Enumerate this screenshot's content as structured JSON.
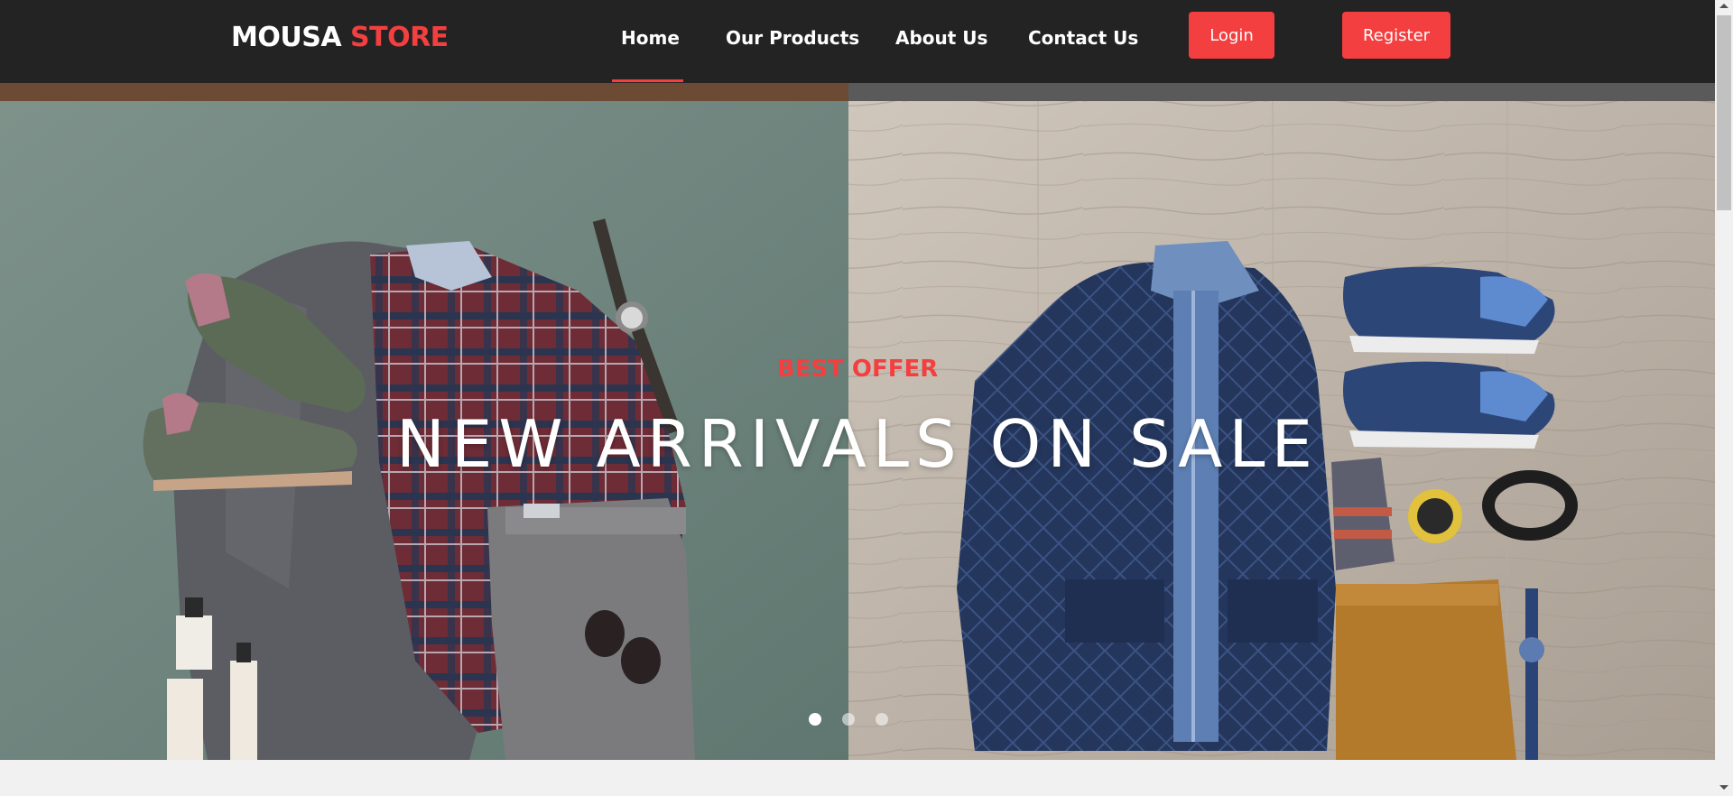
{
  "brand": {
    "name_part1": "MOUSA",
    "name_part2": "STORE",
    "accent_color": "#f33f3f",
    "navbar_color": "#232323"
  },
  "nav": {
    "items": [
      {
        "label": "Home",
        "active": true
      },
      {
        "label": "Our Products",
        "active": false
      },
      {
        "label": "About Us",
        "active": false
      },
      {
        "label": "Contact Us",
        "active": false
      }
    ],
    "login_label": "Login",
    "register_label": "Register"
  },
  "hero": {
    "offer_label": "BEST OFFER",
    "title": "NEW ARRIVALS ON SALE",
    "slides_count": 3,
    "active_slide": 1
  }
}
